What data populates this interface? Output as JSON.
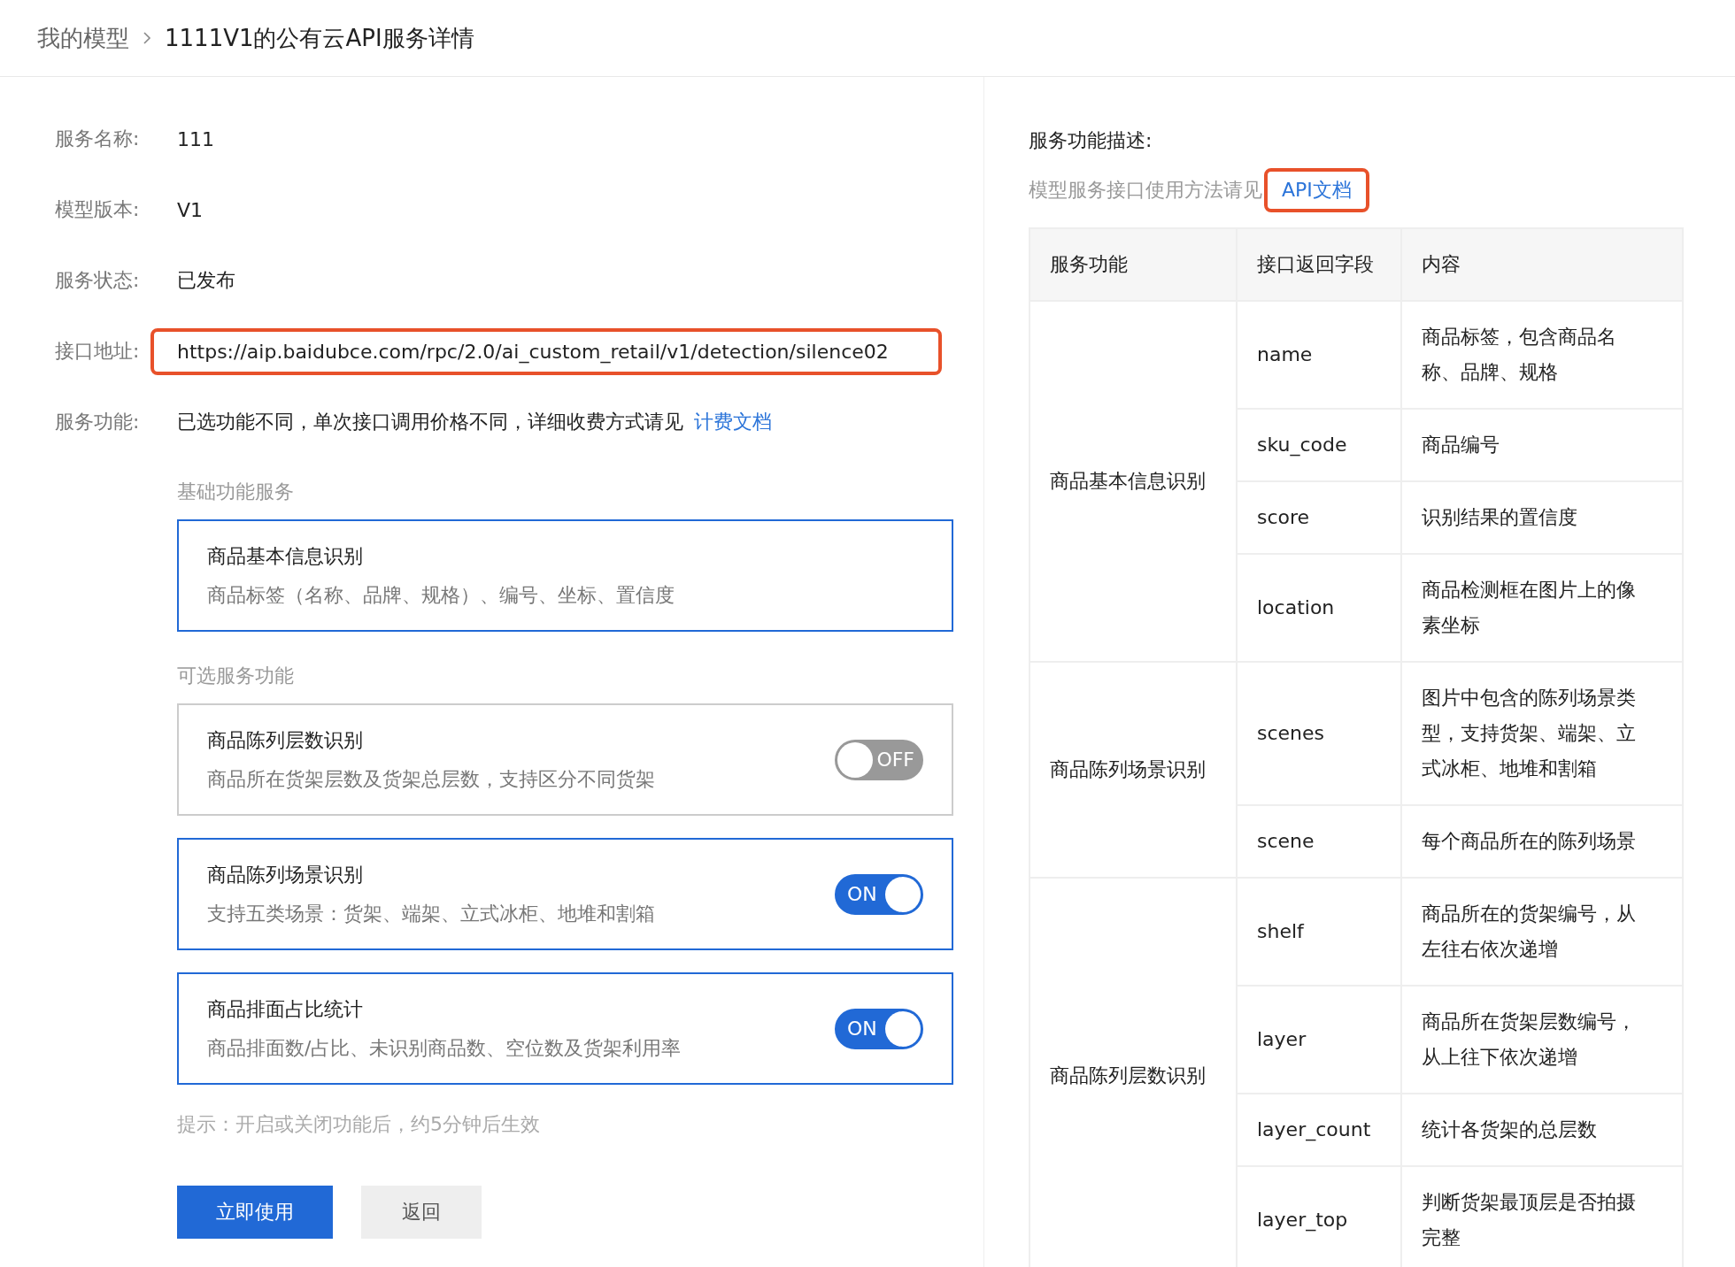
{
  "breadcrumb": {
    "parent": "我的模型",
    "current": "1111V1的公有云API服务详情"
  },
  "info": [
    {
      "label": "服务名称:",
      "value": "111",
      "highlighted": false
    },
    {
      "label": "模型版本:",
      "value": "V1",
      "highlighted": false
    },
    {
      "label": "服务状态:",
      "value": "已发布",
      "highlighted": false
    },
    {
      "label": "接口地址:",
      "value": "https://aip.baidubce.com/rpc/2.0/ai_custom_retail/v1/detection/silence02",
      "highlighted": true
    }
  ],
  "billing": {
    "label": "服务功能:",
    "text": "已选功能不同，单次接口调用价格不同，详细收费方式请见",
    "link": "计费文档"
  },
  "basic_section": {
    "title": "基础功能服务",
    "service": {
      "name": "商品基本信息识别",
      "desc": "商品标签（名称、品牌、规格）、编号、坐标、置信度"
    }
  },
  "optional_section": {
    "title": "可选服务功能",
    "services": [
      {
        "name": "商品陈列层数识别",
        "desc": "商品所在货架层数及货架总层数，支持区分不同货架",
        "on": false,
        "toggle_label": "OFF"
      },
      {
        "name": "商品陈列场景识别",
        "desc": "支持五类场景：货架、端架、立式冰柜、地堆和割箱",
        "on": true,
        "toggle_label": "ON"
      },
      {
        "name": "商品排面占比统计",
        "desc": "商品排面数/占比、未识别商品数、空位数及货架利用率",
        "on": true,
        "toggle_label": "ON"
      }
    ]
  },
  "hint": "提示：开启或关闭功能后，约5分钟后生效",
  "buttons": [
    {
      "label": "立即使用",
      "kind": "primary"
    },
    {
      "label": "返回",
      "kind": "secondary"
    }
  ],
  "description": {
    "title": "服务功能描述:",
    "text": "模型服务接口使用方法请见",
    "link": "API文档",
    "link_highlighted": true
  },
  "table": {
    "columns": [
      "服务功能",
      "接口返回字段",
      "内容"
    ],
    "groups": [
      {
        "function": "商品基本信息识别",
        "fields": [
          {
            "field": "name",
            "content": "商品标签，包含商品名称、品牌、规格"
          },
          {
            "field": "sku_code",
            "content": "商品编号"
          },
          {
            "field": "score",
            "content": "识别结果的置信度"
          },
          {
            "field": "location",
            "content": "商品检测框在图片上的像素坐标"
          }
        ]
      },
      {
        "function": "商品陈列场景识别",
        "fields": [
          {
            "field": "scenes",
            "content": "图片中包含的陈列场景类型，支持货架、端架、立式冰柜、地堆和割箱"
          },
          {
            "field": "scene",
            "content": "每个商品所在的陈列场景"
          }
        ]
      },
      {
        "function": "商品陈列层数识别",
        "fields": [
          {
            "field": "shelf",
            "content": "商品所在的货架编号，从左往右依次递增"
          },
          {
            "field": "layer",
            "content": "商品所在货架层数编号，从上往下依次递增"
          },
          {
            "field": "layer_count",
            "content": "统计各货架的总层数"
          },
          {
            "field": "layer_top",
            "content": "判断货架最顶层是否拍摄完整"
          }
        ]
      }
    ]
  }
}
